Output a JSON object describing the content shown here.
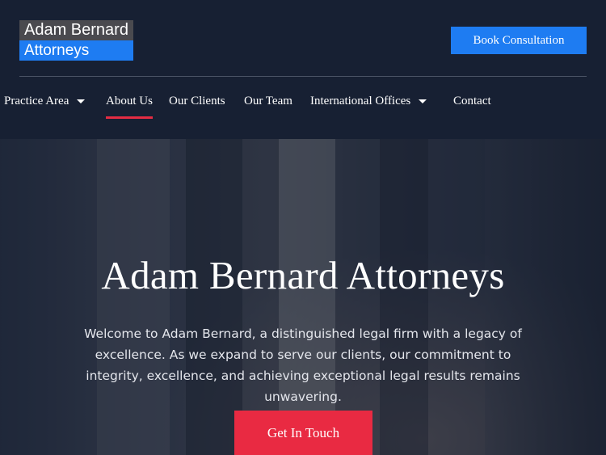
{
  "logo": {
    "line1": "Adam Bernard",
    "line2": "Attorneys"
  },
  "header": {
    "cta_label": "Book Consultation"
  },
  "nav": {
    "items": [
      {
        "label": "Practice Area",
        "has_dropdown": true,
        "active": false
      },
      {
        "label": "About Us",
        "has_dropdown": false,
        "active": true
      },
      {
        "label": "Our Clients",
        "has_dropdown": false,
        "active": false
      },
      {
        "label": "Our Team",
        "has_dropdown": false,
        "active": false
      },
      {
        "label": "International Offices",
        "has_dropdown": true,
        "active": false
      },
      {
        "label": "Contact",
        "has_dropdown": false,
        "active": false
      }
    ]
  },
  "hero": {
    "title": "Adam Bernard Attorneys",
    "description": "Welcome to Adam Bernard, a distinguished legal firm with a legacy of excellence. As we expand to serve our clients, our commitment to integrity, excellence, and achieving exceptional legal results remains unwavering.",
    "button_label": "Get In Touch"
  },
  "colors": {
    "background": "#172033",
    "accent_blue": "#1e7cf2",
    "accent_red": "#e92a42",
    "logo_gray": "#4a4a4f"
  }
}
